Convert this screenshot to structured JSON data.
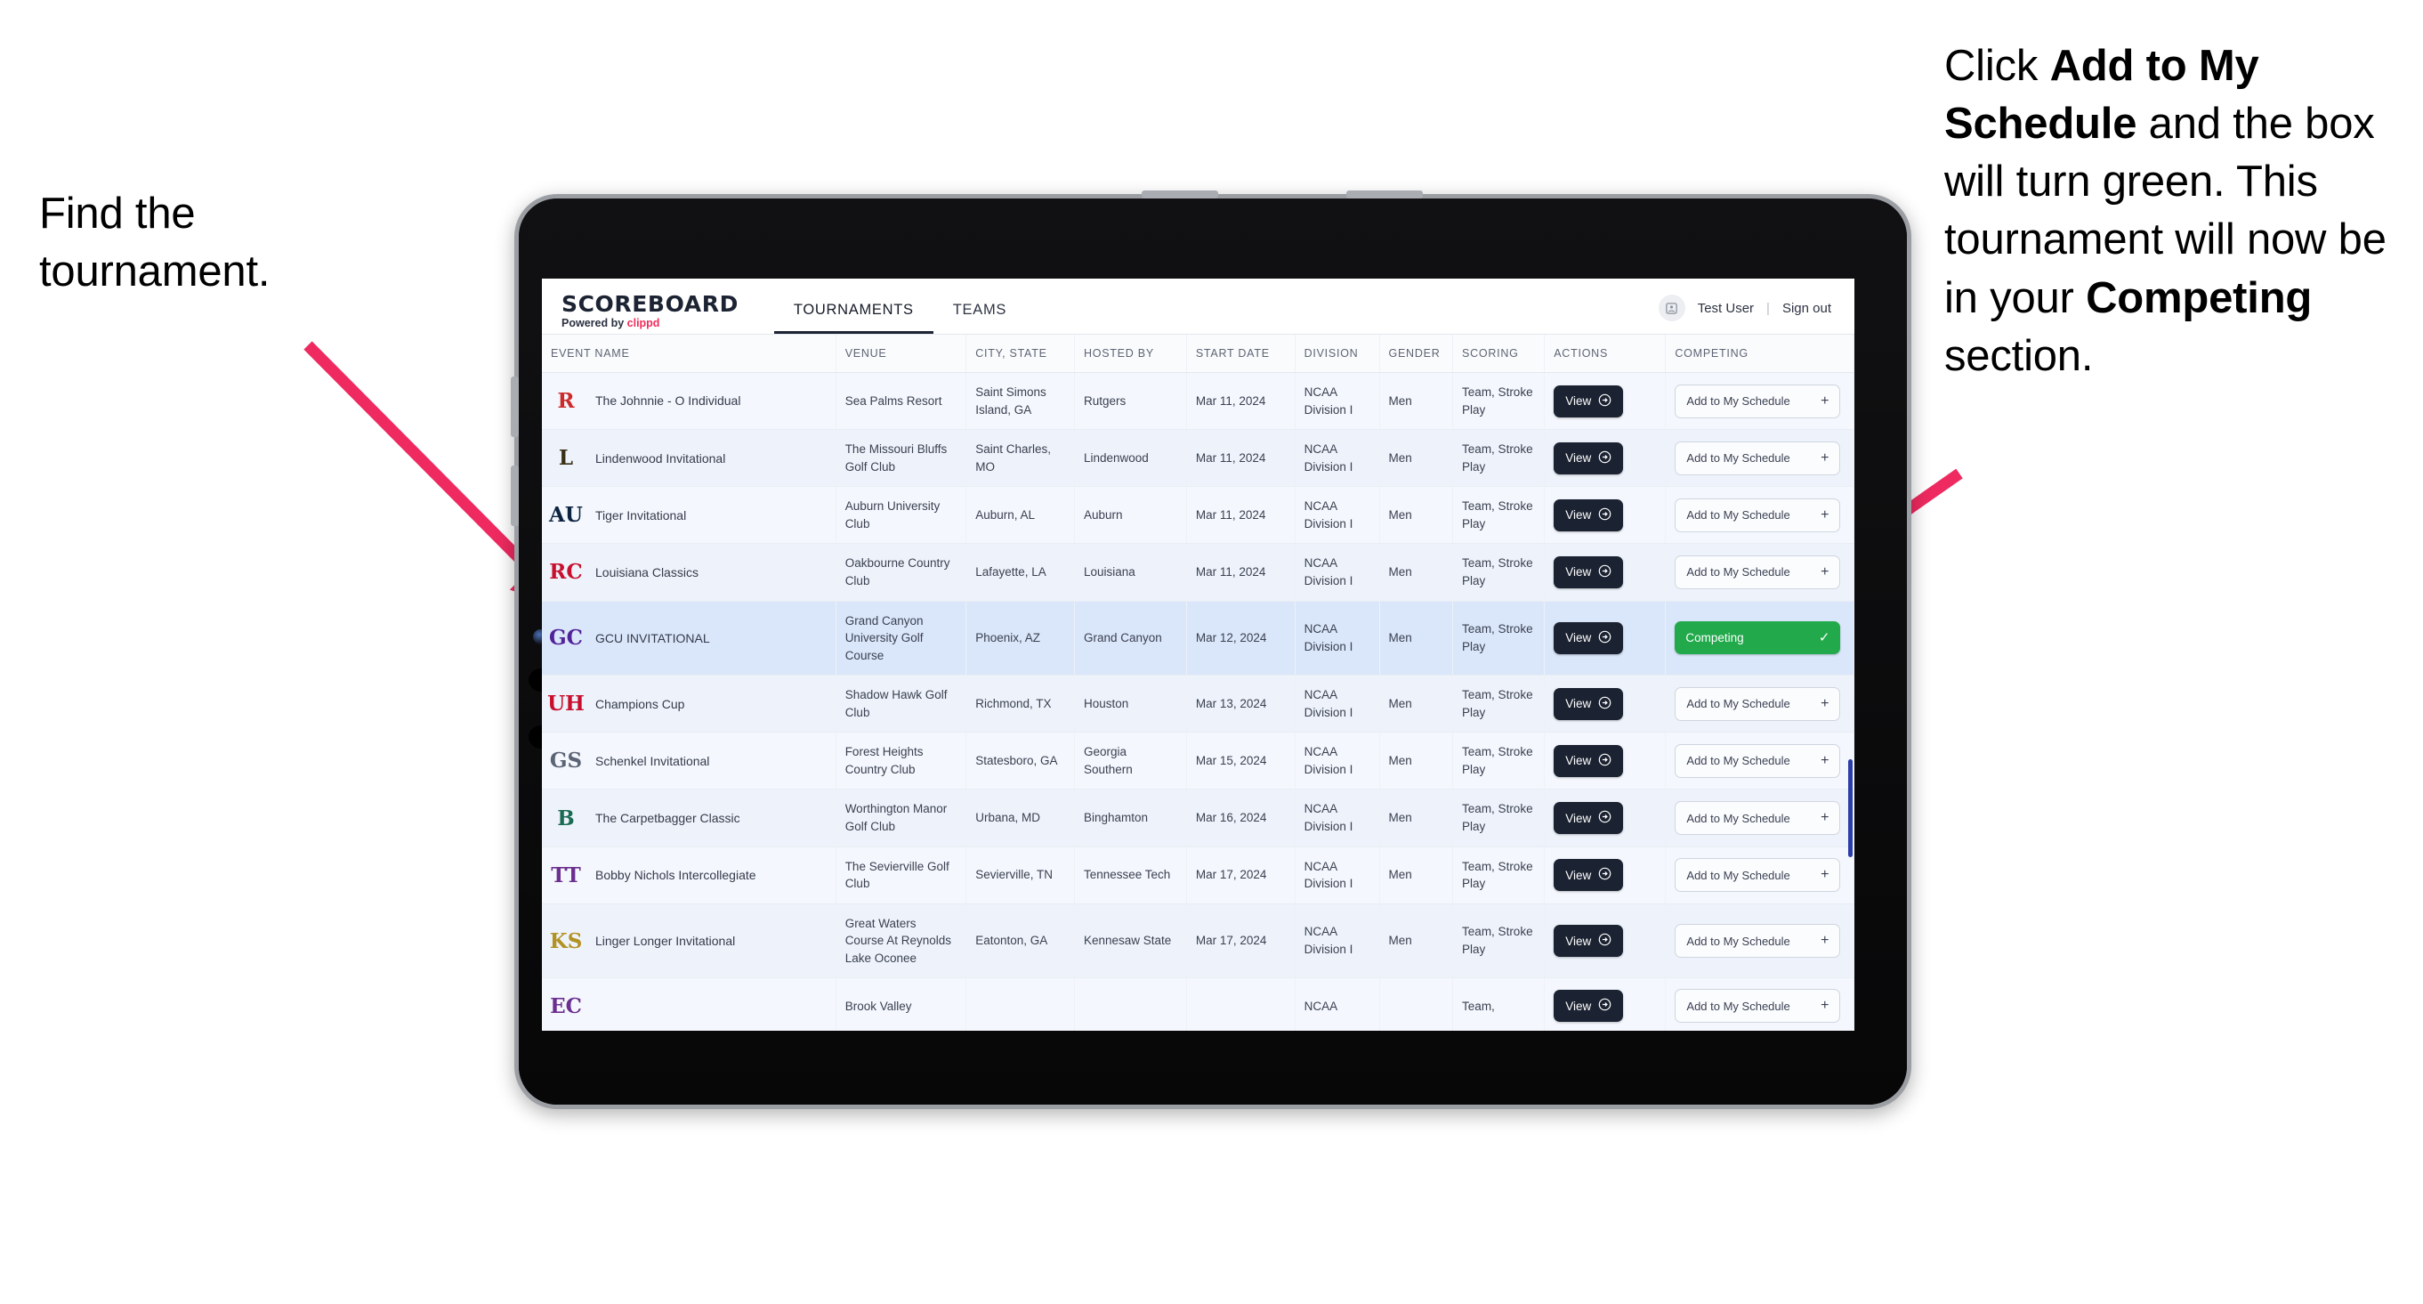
{
  "annotations": {
    "left": {
      "line1": "Find the",
      "line2": "tournament."
    },
    "right": {
      "seg1": "Click ",
      "bold1": "Add to My Schedule",
      "seg2": " and the box will turn green. This tournament will now be in your ",
      "bold2": "Competing",
      "seg3": " section."
    },
    "arrow_color": "#ee2a60"
  },
  "app": {
    "brand": {
      "title": "SCOREBOARD",
      "sub_prefix": "Powered by ",
      "sub_mark": "clippd"
    },
    "nav_tabs": [
      {
        "label": "TOURNAMENTS",
        "active": true
      },
      {
        "label": "TEAMS",
        "active": false
      }
    ],
    "account": {
      "avatar_icon": "user-square-icon",
      "user_name": "Test User",
      "separator": "|",
      "sign_out": "Sign out"
    },
    "table": {
      "columns": [
        "EVENT NAME",
        "VENUE",
        "CITY, STATE",
        "HOSTED BY",
        "START DATE",
        "DIVISION",
        "GENDER",
        "SCORING",
        "ACTIONS",
        "COMPETING"
      ],
      "labels": {
        "view": "View",
        "add": "Add to My Schedule",
        "competing": "Competing",
        "plus": "+",
        "check": "✓",
        "view_arrow": "→"
      },
      "rows": [
        {
          "logo_text": "R",
          "logo_color": "#cc2b2b",
          "logo_bg": "transparent",
          "event": "The Johnnie - O Individual",
          "venue": "Sea Palms Resort",
          "city": "Saint Simons Island, GA",
          "host": "Rutgers",
          "date": "Mar 11, 2024",
          "division": "NCAA Division I",
          "gender": "Men",
          "scoring": "Team, Stroke Play",
          "competing": false
        },
        {
          "logo_text": "L",
          "logo_color": "#3a3118",
          "logo_bg": "transparent",
          "event": "Lindenwood Invitational",
          "venue": "The Missouri Bluffs Golf Club",
          "city": "Saint Charles, MO",
          "host": "Lindenwood",
          "date": "Mar 11, 2024",
          "division": "NCAA Division I",
          "gender": "Men",
          "scoring": "Team, Stroke Play",
          "competing": false
        },
        {
          "logo_text": "AU",
          "logo_color": "#0b2341",
          "logo_bg": "transparent",
          "event": "Tiger Invitational",
          "venue": "Auburn University Club",
          "city": "Auburn, AL",
          "host": "Auburn",
          "date": "Mar 11, 2024",
          "division": "NCAA Division I",
          "gender": "Men",
          "scoring": "Team, Stroke Play",
          "competing": false
        },
        {
          "logo_text": "RC",
          "logo_color": "#c8102e",
          "logo_bg": "transparent",
          "event": "Louisiana Classics",
          "venue": "Oakbourne Country Club",
          "city": "Lafayette, LA",
          "host": "Louisiana",
          "date": "Mar 11, 2024",
          "division": "NCAA Division I",
          "gender": "Men",
          "scoring": "Team, Stroke Play",
          "competing": false
        },
        {
          "logo_text": "GC",
          "logo_color": "#522398",
          "logo_bg": "transparent",
          "event": "GCU INVITATIONAL",
          "venue": "Grand Canyon University Golf Course",
          "city": "Phoenix, AZ",
          "host": "Grand Canyon",
          "date": "Mar 12, 2024",
          "division": "NCAA Division I",
          "gender": "Men",
          "scoring": "Team, Stroke Play",
          "competing": true
        },
        {
          "logo_text": "UH",
          "logo_color": "#c8102e",
          "logo_bg": "transparent",
          "event": "Champions Cup",
          "venue": "Shadow Hawk Golf Club",
          "city": "Richmond, TX",
          "host": "Houston",
          "date": "Mar 13, 2024",
          "division": "NCAA Division I",
          "gender": "Men",
          "scoring": "Team, Stroke Play",
          "competing": false
        },
        {
          "logo_text": "GS",
          "logo_color": "#5a6475",
          "logo_bg": "transparent",
          "event": "Schenkel Invitational",
          "venue": "Forest Heights Country Club",
          "city": "Statesboro, GA",
          "host": "Georgia Southern",
          "date": "Mar 15, 2024",
          "division": "NCAA Division I",
          "gender": "Men",
          "scoring": "Team, Stroke Play",
          "competing": false
        },
        {
          "logo_text": "B",
          "logo_color": "#1a6b52",
          "logo_bg": "transparent",
          "event": "The Carpetbagger Classic",
          "venue": "Worthington Manor Golf Club",
          "city": "Urbana, MD",
          "host": "Binghamton",
          "date": "Mar 16, 2024",
          "division": "NCAA Division I",
          "gender": "Men",
          "scoring": "Team, Stroke Play",
          "competing": false
        },
        {
          "logo_text": "TT",
          "logo_color": "#6b2f8f",
          "logo_bg": "transparent",
          "event": "Bobby Nichols Intercollegiate",
          "venue": "The Sevierville Golf Club",
          "city": "Sevierville, TN",
          "host": "Tennessee Tech",
          "date": "Mar 17, 2024",
          "division": "NCAA Division I",
          "gender": "Men",
          "scoring": "Team, Stroke Play",
          "competing": false
        },
        {
          "logo_text": "KS",
          "logo_color": "#b39224",
          "logo_bg": "transparent",
          "event": "Linger Longer Invitational",
          "venue": "Great Waters Course At Reynolds Lake Oconee",
          "city": "Eatonton, GA",
          "host": "Kennesaw State",
          "date": "Mar 17, 2024",
          "division": "NCAA Division I",
          "gender": "Men",
          "scoring": "Team, Stroke Play",
          "competing": false
        },
        {
          "logo_text": "EC",
          "logo_color": "#6b2f8f",
          "logo_bg": "transparent",
          "event": "",
          "venue": "Brook Valley",
          "city": "",
          "host": "",
          "date": "",
          "division": "NCAA",
          "gender": "",
          "scoring": "Team,",
          "competing": false
        }
      ]
    }
  }
}
